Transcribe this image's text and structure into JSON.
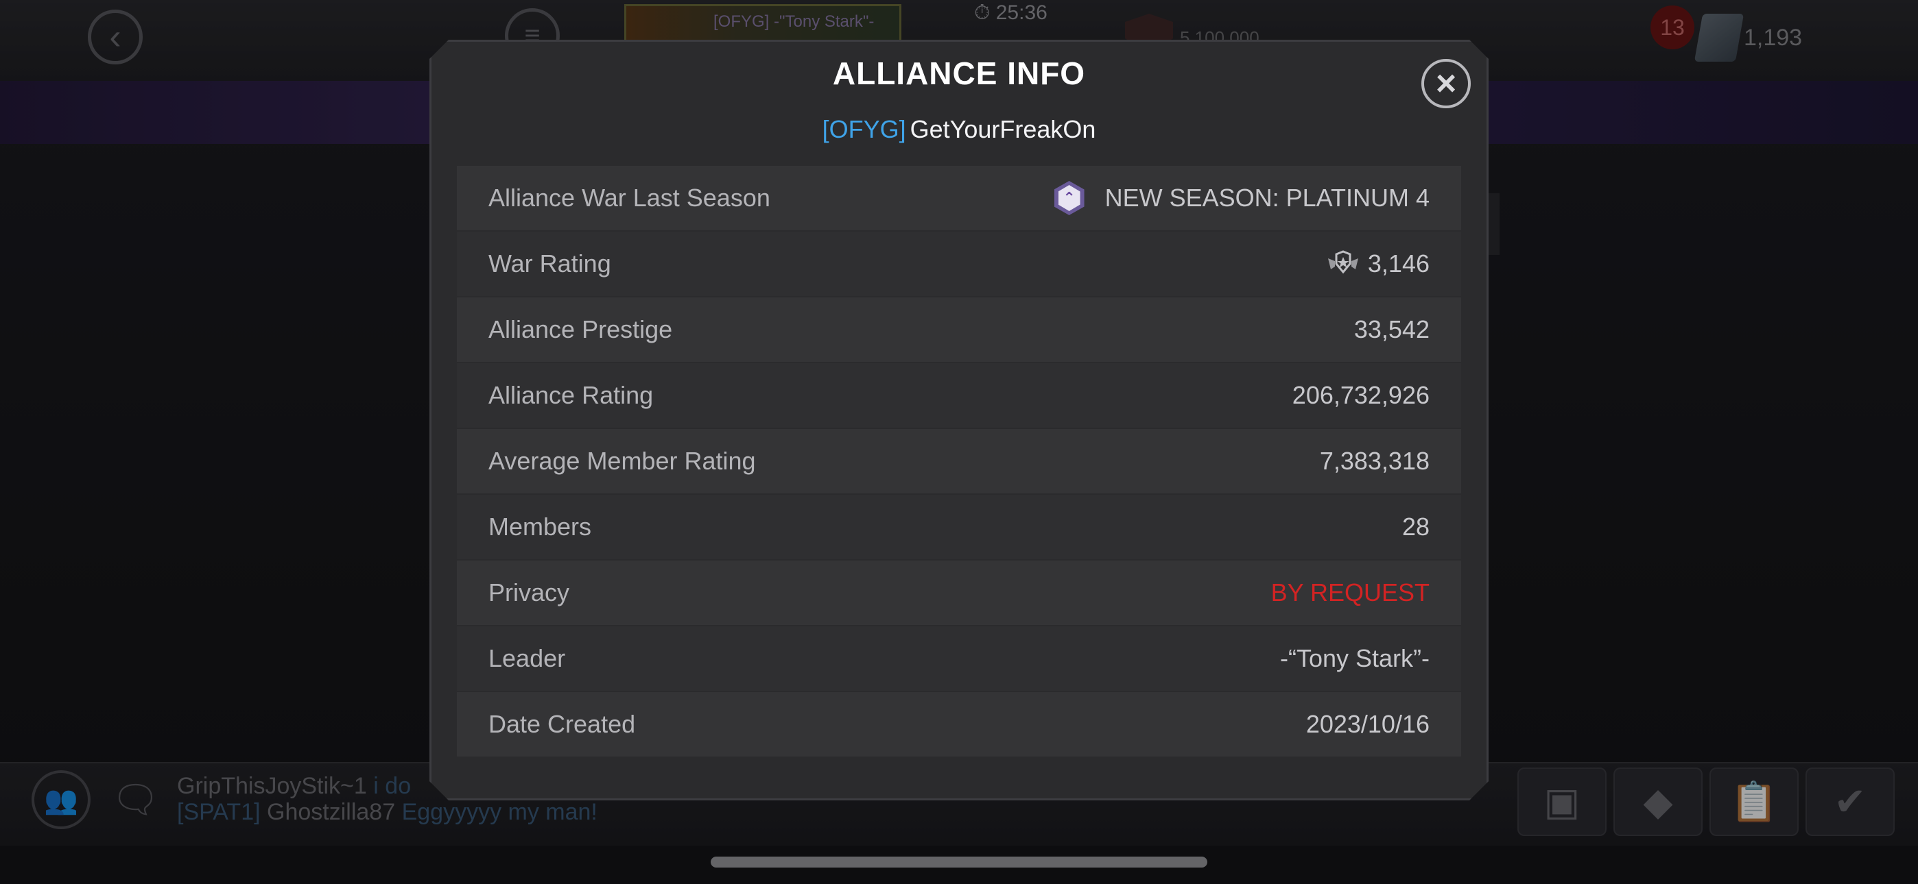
{
  "hud": {
    "back_icon": "chevron-left-icon",
    "champion_name": "[OFYG] -\"Tony Stark\"-",
    "timer": "25:36",
    "bg_stat": "5,100,000",
    "notification_count": "13",
    "currency_value": "1,193"
  },
  "modal": {
    "title": "ALLIANCE INFO",
    "close_icon": "close-icon",
    "alliance_tag": "[OFYG]",
    "alliance_name": "GetYourFreakOn",
    "rows": [
      {
        "label": "Alliance War Last Season",
        "value": "NEW SEASON: PLATINUM 4",
        "icon": "platinum-tier-icon"
      },
      {
        "label": "War Rating",
        "value": "3,146",
        "icon": "war-rating-icon"
      },
      {
        "label": "Alliance Prestige",
        "value": "33,542"
      },
      {
        "label": "Alliance Rating",
        "value": "206,732,926"
      },
      {
        "label": "Average Member Rating",
        "value": "7,383,318"
      },
      {
        "label": "Members",
        "value": "28"
      },
      {
        "label": "Privacy",
        "value": "BY REQUEST",
        "color": "#d32323"
      },
      {
        "label": "Leader",
        "value": "-“Tony Stark”-"
      },
      {
        "label": "Date Created",
        "value": "2023/10/16"
      }
    ]
  },
  "chat": {
    "line1_user": "GripThisJoyStik~1",
    "line1_msg": "i do",
    "line2_tag": "[SPAT1]",
    "line2_user": "Ghostzilla87",
    "line2_msg": "Eggyyyyy my man!"
  },
  "colors": {
    "accent_blue": "#3fa3e8",
    "privacy_red": "#d32323",
    "modal_bg": "#2b2b2d"
  }
}
